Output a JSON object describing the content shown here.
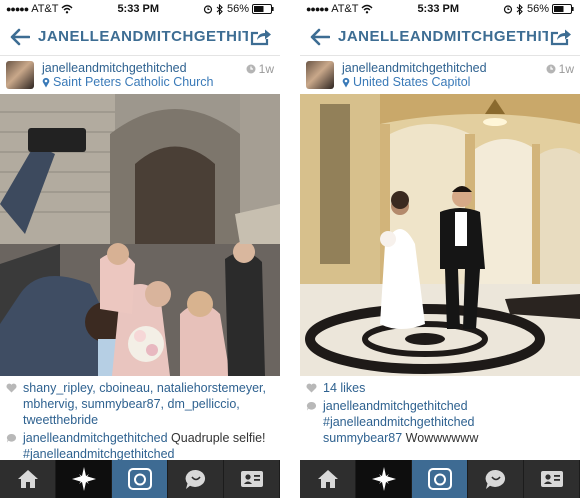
{
  "colors": {
    "accent": "#3d6d93",
    "link": "#2f6290",
    "location": "#3a7ab8",
    "tabbar": "#2e2e2e",
    "camera_tab": "#3e6b93"
  },
  "left": {
    "status": {
      "carrier": "AT&T",
      "time": "5:33 PM",
      "battery": "56%"
    },
    "nav": {
      "title": "JANELLEANDMITCHGETHITCHED",
      "back_icon": "arrow-left-icon",
      "share_icon": "share-icon"
    },
    "post": {
      "username": "janelleandmitchgethitched",
      "location": "Saint Peters Catholic Church",
      "time": "1w",
      "likes": "shany_ripley, cboineau, nataliehorstemeyer, mbhervig, summybear87, dm_pelliccio, tweetthebride",
      "comment_user": "janelleandmitchgethitched",
      "comment_text": " Quadruple selfie!",
      "comment_hashtag": "#janelleandmitchgethitched"
    }
  },
  "right": {
    "status": {
      "carrier": "AT&T",
      "time": "5:33 PM",
      "battery": "56%"
    },
    "nav": {
      "title": "JANELLEANDMITCHGETHITCHED",
      "back_icon": "arrow-left-icon",
      "share_icon": "share-icon"
    },
    "post": {
      "username": "janelleandmitchgethitched",
      "location": "United States Capitol",
      "time": "1w",
      "likes": "14 likes",
      "comment_user": "janelleandmitchgethitched",
      "comment_hashtag": "#janelleandmitchgethitched",
      "comment2_user": "summybear87",
      "comment2_text": " Wowwwwww"
    }
  },
  "tabs": [
    "home-icon",
    "explore-star-icon",
    "camera-icon",
    "news-bubble-icon",
    "profile-card-icon"
  ]
}
